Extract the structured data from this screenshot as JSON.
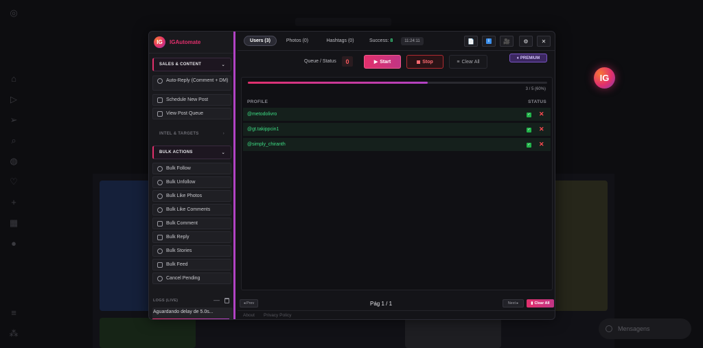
{
  "background": {
    "messages_label": "Mensagens"
  },
  "floating_logo": "IG",
  "brand": {
    "logo": "IG",
    "name": "IGAutomate"
  },
  "sidebar": {
    "sections": {
      "sales": "SALES & CONTENT",
      "intel": "INTEL & TARGETS",
      "bulk": "BULK ACTIONS"
    },
    "sales_items": [
      {
        "label": "Auto-Reply (Comment + DM)",
        "icon": "chat-icon"
      },
      {
        "label": "Schedule New Post",
        "icon": "calendar-icon"
      },
      {
        "label": "View Post Queue",
        "icon": "queue-icon"
      }
    ],
    "bulk_items": [
      {
        "label": "Bulk Follow",
        "icon": "user-plus-icon"
      },
      {
        "label": "Bulk Unfollow",
        "icon": "user-minus-icon"
      },
      {
        "label": "Bulk Like Photos",
        "icon": "heart-icon"
      },
      {
        "label": "Bulk Like Comments",
        "icon": "heart-icon"
      },
      {
        "label": "Bulk Comment",
        "icon": "comment-icon"
      },
      {
        "label": "Bulk Reply",
        "icon": "reply-icon"
      },
      {
        "label": "Bulk Stories",
        "icon": "story-icon"
      },
      {
        "label": "Bulk Feed",
        "icon": "image-icon"
      },
      {
        "label": "Cancel Pending",
        "icon": "cancel-icon"
      }
    ],
    "logs": {
      "label": "LOGS (LIVE)",
      "text": "Aguardando delay de 5.0s..."
    }
  },
  "tabs": [
    {
      "label": "Users (3)",
      "active": true
    },
    {
      "label": "Photos (0)",
      "active": false
    },
    {
      "label": "Hashtags (0)",
      "active": false
    }
  ],
  "status": {
    "success_label": "Success:",
    "success_count": "8",
    "time": "11:24:11"
  },
  "controls": {
    "queue_label": "Queue / Status",
    "queue_count": "0",
    "start": "Start",
    "stop": "Stop",
    "clear_all": "Clear All",
    "premium": "PREMIUM"
  },
  "progress": {
    "fraction": 0.6,
    "text": "3 / 5 (60%)"
  },
  "table": {
    "columns": [
      "PROFILE",
      "STATUS"
    ],
    "rows": [
      {
        "profile": "@metodolivro"
      },
      {
        "profile": "@gt.takippcin1"
      },
      {
        "profile": "@simply_chiranth"
      }
    ]
  },
  "pager": {
    "prev": "◂ Prev",
    "page": "Pág 1 / 1",
    "next": "Next ▸",
    "clear_all": "Clear All"
  },
  "footer": {
    "about": "About",
    "privacy": "Privacy Policy"
  },
  "colors": {
    "accent": "#e1306c",
    "purple": "#b243c4",
    "success": "#3ddc84",
    "danger": "#ff4a50"
  }
}
